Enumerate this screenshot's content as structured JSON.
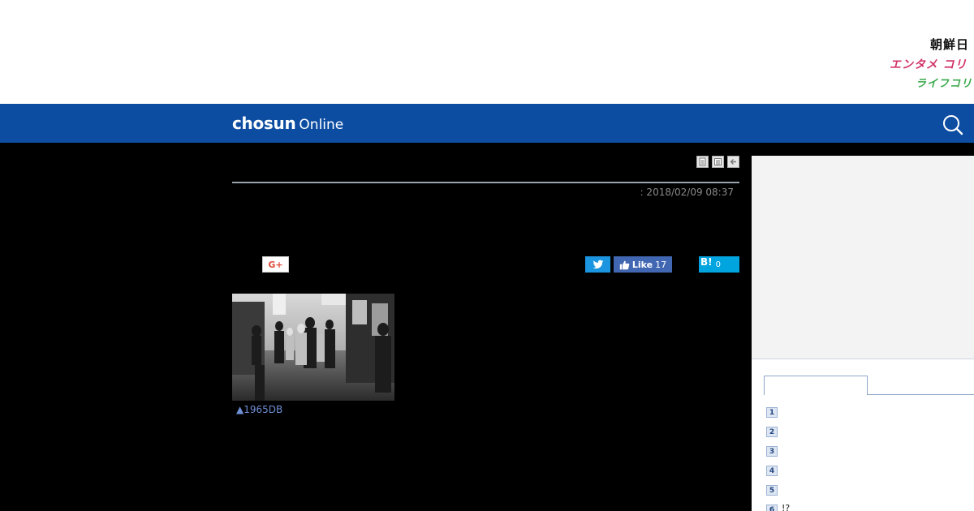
{
  "header": {
    "brand_lines": [
      "朝鮮日",
      "エンタメ コリ",
      "ライフコリ"
    ]
  },
  "nav": {
    "logo_main": "chosun",
    "logo_sub": "Online",
    "search_icon": "search-icon"
  },
  "article": {
    "tool_icons": [
      "print-icon",
      "list-icon",
      "back-arrow-icon"
    ],
    "date_text": ": 2018/02/09 08:37",
    "photo_caption": "▲1965DB"
  },
  "share": {
    "gplus_label": "G+",
    "like_label": "Like",
    "like_count": "17",
    "hatena_label": "B!",
    "hatena_count": "0"
  },
  "sidebar": {
    "ranking": [
      {
        "num": "1",
        "text": ""
      },
      {
        "num": "2",
        "text": ""
      },
      {
        "num": "3",
        "text": ""
      },
      {
        "num": "4",
        "text": ""
      },
      {
        "num": "5",
        "text": ""
      },
      {
        "num": "6",
        "text": "!?"
      }
    ]
  },
  "colors": {
    "nav_bg": "#0c4da2",
    "twitter": "#1b95e0",
    "facebook": "#4267b2",
    "hatena": "#00a4de",
    "gplus": "#dd4b39"
  }
}
